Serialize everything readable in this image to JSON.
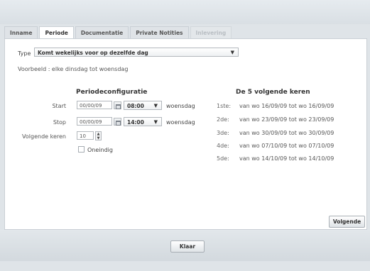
{
  "tabs": [
    {
      "label": "Inname"
    },
    {
      "label": "Periode"
    },
    {
      "label": "Documentatie"
    },
    {
      "label": "Private Notities"
    },
    {
      "label": "Inlevering"
    }
  ],
  "type": {
    "label": "Type",
    "value": "Komt wekelijks voor op dezelfde dag"
  },
  "example": "Voorbeeld : elke dinsdag tot woensdag",
  "config": {
    "title": "Periodeconfiguratie",
    "start": {
      "label": "Start",
      "date": "00/00/09",
      "time": "08:00",
      "day": "woensdag"
    },
    "stop": {
      "label": "Stop",
      "date": "00/00/09",
      "time": "14:00",
      "day": "woensdag"
    },
    "following": {
      "label": "Volgende keren",
      "value": "10"
    },
    "checkbox_label": "Oneindig"
  },
  "next": {
    "title": "De 5 volgende keren",
    "items": [
      {
        "index": "1ste:",
        "text": "van wo 16/09/09 tot wo 16/09/09"
      },
      {
        "index": "2de:",
        "text": "van wo 23/09/09 tot wo 23/09/09"
      },
      {
        "index": "3de:",
        "text": "van wo 30/09/09 tot wo 30/09/09"
      },
      {
        "index": "4de:",
        "text": "van wo 07/10/09 tot wo 07/10/09"
      },
      {
        "index": "5de:",
        "text": "van wo 14/10/09 tot wo 14/10/09"
      }
    ]
  },
  "buttons": {
    "next": "Volgende",
    "done": "Klaar"
  }
}
